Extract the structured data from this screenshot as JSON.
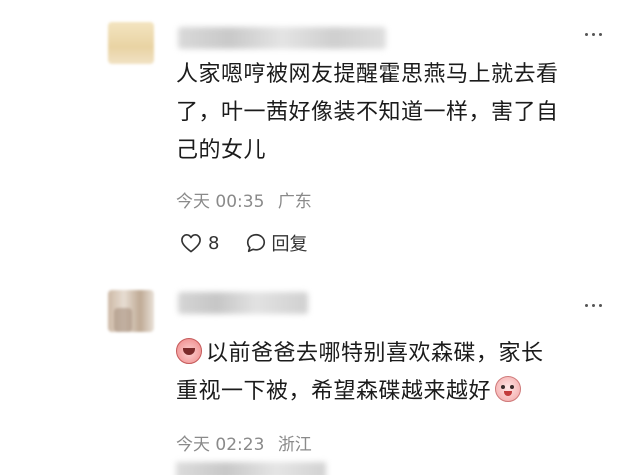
{
  "comments": [
    {
      "text_lines": [
        "人家嗯哼被网友提醒霍思燕马上就去看",
        "了，叶一茜好像装不知道一样，害了自",
        "己的女儿"
      ],
      "time": "今天 00:35",
      "location": "广东",
      "likes": "8",
      "reply_label": "回复",
      "icons": {
        "more": "more-icon",
        "like": "heart-outline-icon",
        "reply": "comment-bubble-icon"
      }
    },
    {
      "line1": "以前爸爸去哪特别喜欢森碟，家长",
      "line2": "重视一下被，希望森碟越来越好",
      "emojis": [
        "crying-face-emoji",
        "smiling-face-emoji"
      ],
      "time": "今天 02:23",
      "location": "浙江",
      "icons": {
        "more": "more-icon"
      }
    }
  ]
}
